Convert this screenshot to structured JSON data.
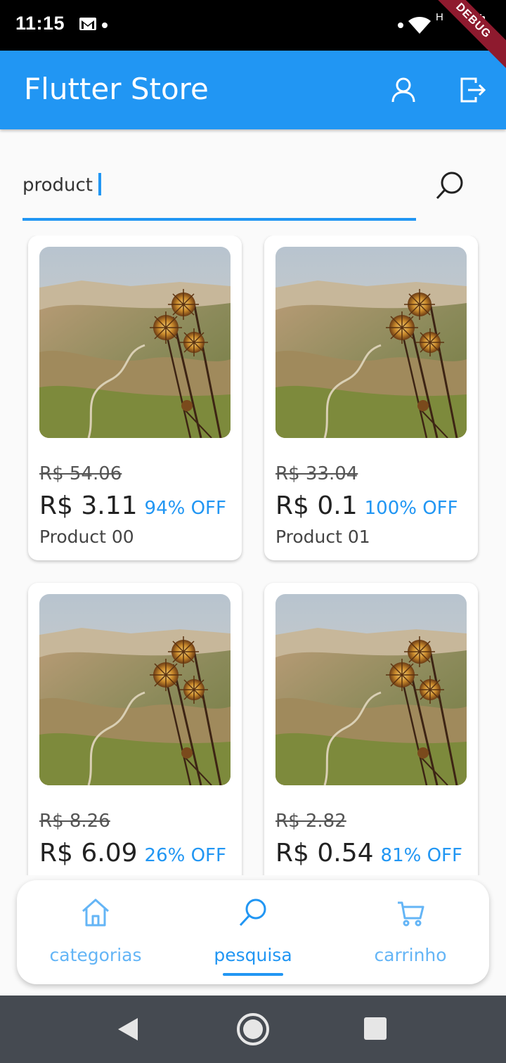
{
  "status_bar": {
    "time": "11:15",
    "network_label": "H",
    "debug_label": "DEBUG",
    "icons": [
      "gmail-icon",
      "notification-dot",
      "wifi-icon",
      "battery-icon"
    ]
  },
  "app_bar": {
    "title": "Flutter Store",
    "actions": [
      "account-icon",
      "logout-icon"
    ]
  },
  "search": {
    "value": "product",
    "icon": "search-icon"
  },
  "products": [
    {
      "old_price": "R$ 54.06",
      "price": "R$ 3.11",
      "discount": "94% OFF",
      "name": "Product 00"
    },
    {
      "old_price": "R$ 33.04",
      "price": "R$ 0.1",
      "discount": "100% OFF",
      "name": "Product 01"
    },
    {
      "old_price": "R$ 8.26",
      "price": "R$ 6.09",
      "discount": "26% OFF",
      "name": ""
    },
    {
      "old_price": "R$ 2.82",
      "price": "R$ 0.54",
      "discount": "81% OFF",
      "name": ""
    }
  ],
  "bottom_nav": {
    "items": [
      {
        "label": "categorias",
        "icon": "home-icon"
      },
      {
        "label": "pesquisa",
        "icon": "search-icon"
      },
      {
        "label": "carrinho",
        "icon": "cart-icon"
      }
    ],
    "selected": "pesquisa"
  },
  "colors": {
    "primary": "#2196f3",
    "primary_light": "#64b5f6",
    "background": "#fafafa",
    "debug_banner": "#8e1a2e",
    "system_nav": "#454a51"
  }
}
